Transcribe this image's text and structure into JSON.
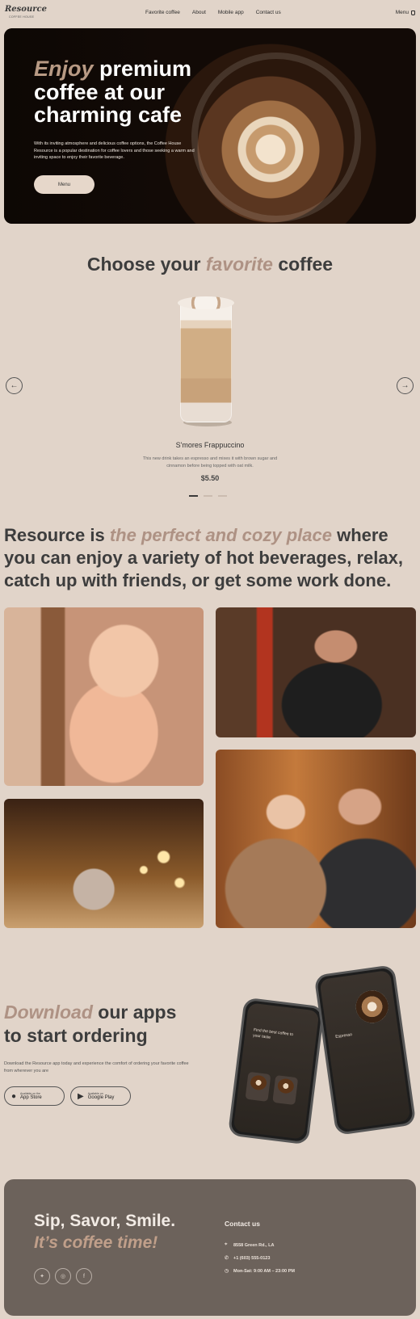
{
  "nav": {
    "logo": "Resource",
    "logo_sub": "Coffee House",
    "links": [
      "Favorite coffee",
      "About",
      "Mobile app",
      "Contact us"
    ],
    "menu_label": "Menu"
  },
  "hero": {
    "title_accent": "Enjoy",
    "title_rest": "premium coffee at our charming cafe",
    "text": "With its inviting atmosphere and delicious coffee options, the Coffee House Resource is a popular destination for coffee lovers and those seeking a warm and inviting space to enjoy their favorite beverage.",
    "button": "Menu"
  },
  "favorite": {
    "title_start": "Choose your",
    "title_accent": "favorite",
    "title_end": "coffee",
    "prev_icon": "←",
    "next_icon": "→",
    "product_name": "S'mores Frappuccino",
    "product_desc": "This new drink takes an espresso and mixes it with brown sugar and cinnamon before being topped with oat milk.",
    "product_price": "$5.50"
  },
  "about": {
    "text_start": "Resource is",
    "text_accent": "the perfect and cozy place",
    "text_end": "where you can enjoy a variety of hot beverages, relax, catch up with friends, or get some work done."
  },
  "download": {
    "title_accent": "Download",
    "title_rest_1": "our apps",
    "title_rest_2": "to start ordering",
    "text": "Download the Resource app today and experience the comfort of ordering your favorite coffee from wherever you are",
    "appstore_small": "Available on the",
    "appstore_big": "App Store",
    "googleplay_small": "Available on",
    "googleplay_big": "Google Play",
    "phone1_text": "Find the best coffee to your taste",
    "phone2_text": "Espresso"
  },
  "footer": {
    "line1": "Sip, Savor, Smile.",
    "line2": "It’s coffee time!",
    "contact_title": "Contact us",
    "address": "8558 Green Rd., LA",
    "phone": "+1 (603) 555-0123",
    "hours": "Mon-Sat: 9:00 AM – 23:00 PM"
  }
}
